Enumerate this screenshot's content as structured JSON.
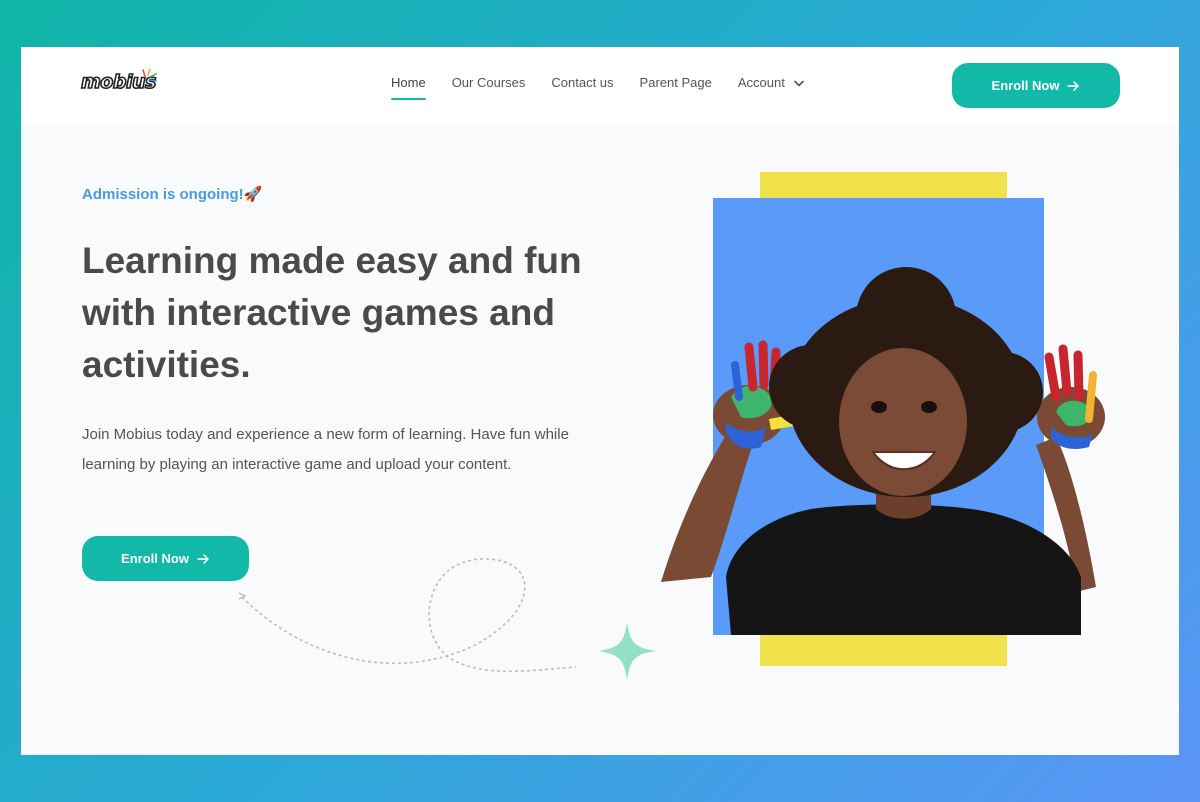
{
  "logo": {
    "text": "mobius"
  },
  "nav": {
    "items": [
      {
        "label": "Home",
        "active": true
      },
      {
        "label": "Our Courses"
      },
      {
        "label": "Contact us"
      },
      {
        "label": "Parent Page"
      },
      {
        "label": "Account",
        "dropdown": true
      }
    ]
  },
  "header": {
    "enroll_label": "Enroll Now"
  },
  "hero": {
    "eyebrow": "Admission is ongoing!🚀",
    "headline": "Learning made easy and fun with interactive games and activities.",
    "paragraph": "Join Mobius today and experience a new form of learning. Have fun while learning by playing an interactive game and upload your content.",
    "cta_label": "Enroll Now"
  },
  "colors": {
    "accent": "#12b8a8",
    "eyebrow": "#4a9bdf",
    "panel_blue": "#5a9af8",
    "panel_yellow": "#f1e24c",
    "sparkle": "#92e0c8"
  },
  "icons": {
    "arrow": "arrow-right-icon",
    "chevron": "chevron-down-icon",
    "sparkle": "sparkle-icon"
  }
}
